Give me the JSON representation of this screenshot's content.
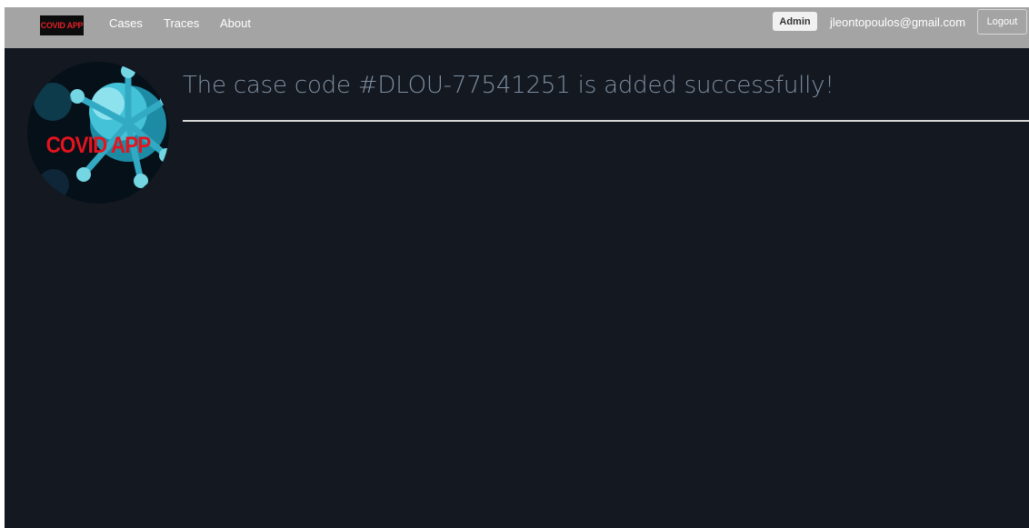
{
  "navbar": {
    "brand_label": "COVID APP",
    "links": {
      "cases": "Cases",
      "traces": "Traces",
      "about": "About"
    },
    "role_badge": "Admin",
    "user_email": "jleontopoulos@gmail.com",
    "logout_label": "Logout"
  },
  "main": {
    "logo_text": "COVID APP",
    "success_message": "The case code #DLOU-77541251 is added successfully!"
  },
  "colors": {
    "navbar_bg": "#a4a4a4",
    "page_bg": "#141820",
    "brand_red": "#e1202a",
    "message_text": "#7e8fa1",
    "virus_cyan": "#2fb6cf"
  },
  "icons": {
    "logo": "virus-logo-icon"
  }
}
